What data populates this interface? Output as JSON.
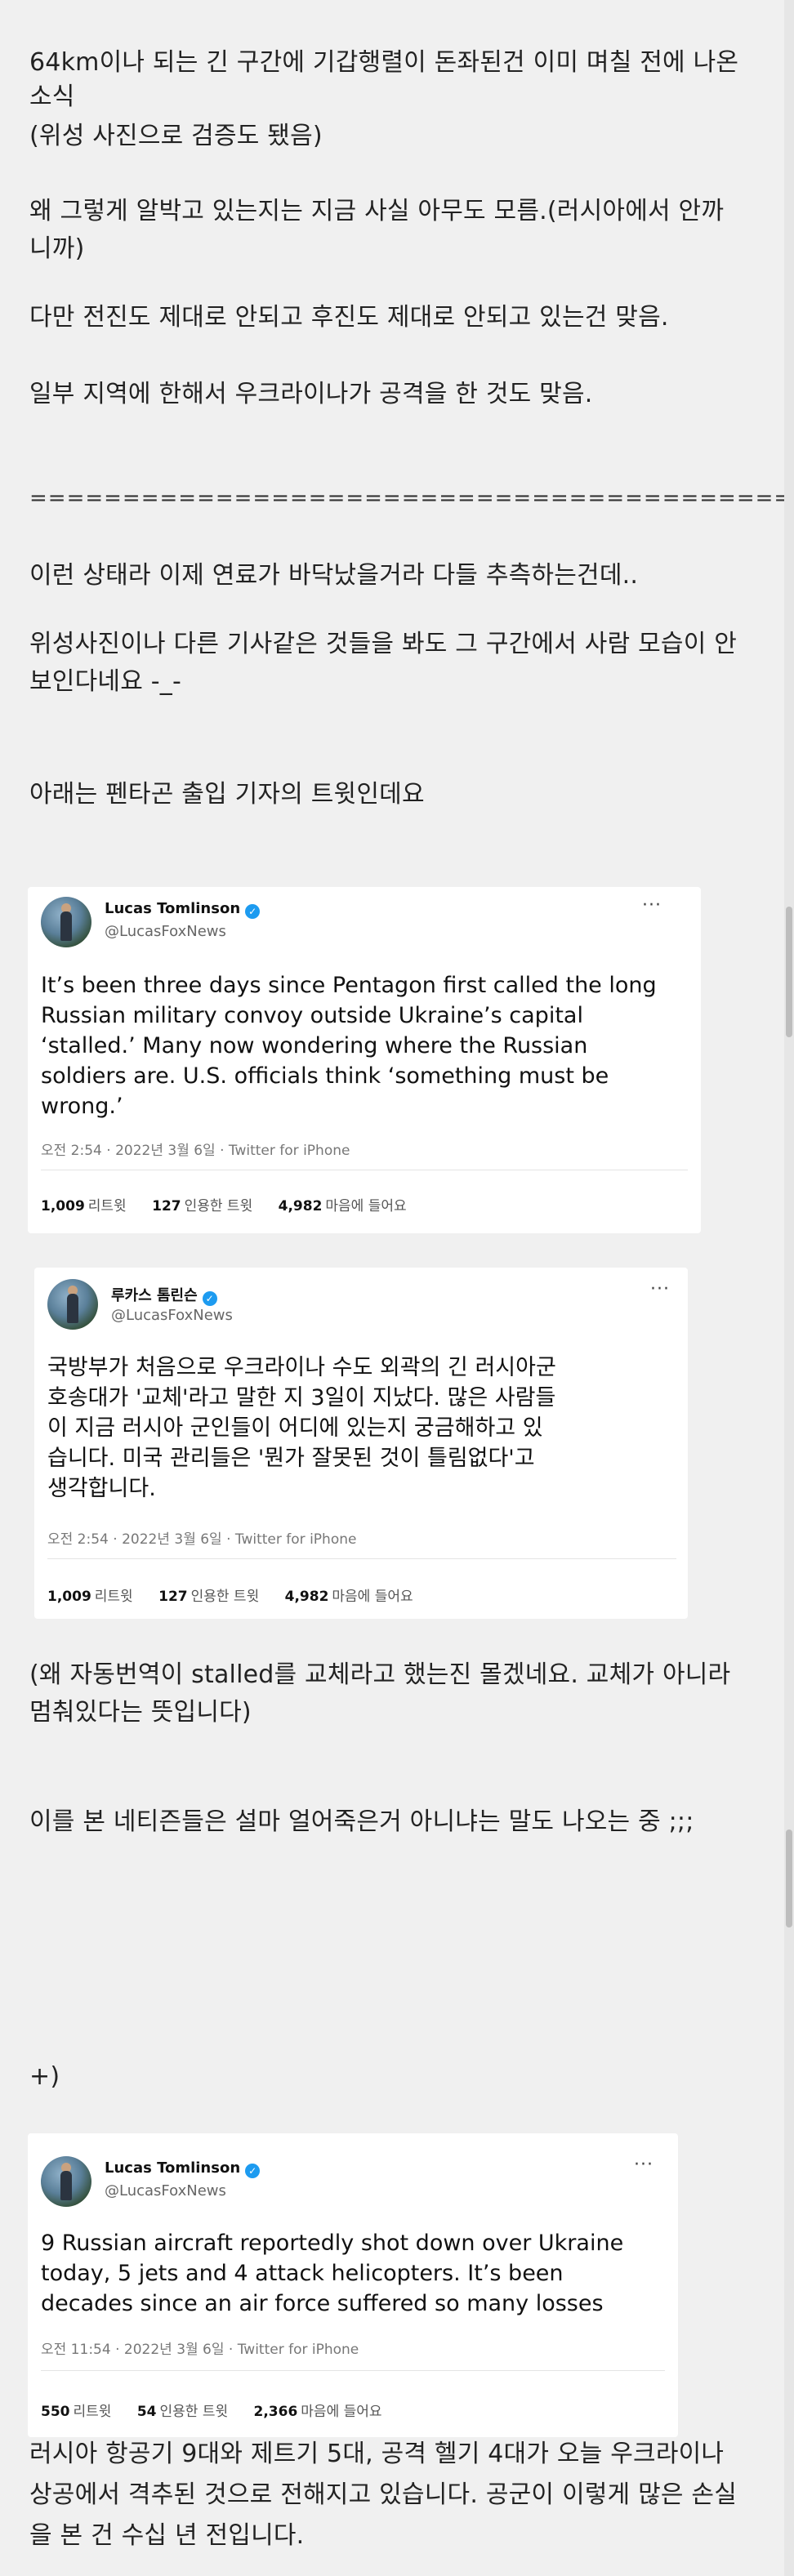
{
  "post": {
    "para1_l1": "64km이나 되는 긴 구간에 기갑행렬이 돈좌된건 이미 며칠 전에 나온",
    "para1_l2": "소식",
    "para1_l3": "(위성 사진으로 검증도 됐음)",
    "para2_l1": "왜 그렇게 알박고 있는지는 지금 사실 아무도 모름.(러시아에서 안까",
    "para2_l2": "니까)",
    "para3": "다만 전진도 제대로 안되고 후진도 제대로 안되고 있는건 맞음.",
    "para4": "일부 지역에 한해서 우크라이나가 공격을 한 것도 맞음.",
    "separator": "=========================================",
    "para5": "이런 상태라 이제 연료가 바닥났을거라 다들 추측하는건데..",
    "para6_l1": "위성사진이나 다른 기사같은 것들을 봐도 그 구간에서 사람 모습이 안",
    "para6_l2": "보인다네요 -_-",
    "para7": "아래는 펜타곤 출입 기자의 트윗인데요",
    "para8_l1": "(왜 자동번역이 stalled를 교체라고 했는진 몰겠네요. 교체가 아니라",
    "para8_l2": "멈춰있다는 뜻입니다)",
    "para9": "이를 본 네티즌들은 설마 얼어죽은거 아니냐는 말도 나오는 중 ;;;",
    "plus": "+)",
    "para10_l1": "러시아 항공기 9대와 제트기 5대, 공격 헬기 4대가 오늘 우크라이나",
    "para10_l2": "상공에서 격추된 것으로 전해지고 있습니다. 공군이 이렇게 많은 손실",
    "para10_l3": "을 본 건 수십 년 전입니다."
  },
  "tweet1": {
    "name": "Lucas Tomlinson",
    "handle": "@LucasFoxNews",
    "more": "···",
    "lines": [
      "It’s been three days since Pentagon first called the long",
      "Russian military convoy outside Ukraine’s capital",
      "‘stalled.’ Many now wondering where the Russian",
      "soldiers are. U.S. officials think ‘something must be",
      "wrong.’"
    ],
    "meta": "오전 2:54 · 2022년 3월 6일 · Twitter for iPhone",
    "retweets": "1,009",
    "retweets_label": "리트윗",
    "quotes": "127",
    "quotes_label": "인용한 트윗",
    "likes": "4,982",
    "likes_label": "마음에 들어요"
  },
  "tweet2": {
    "name": "루카스 톰린슨",
    "handle": "@LucasFoxNews",
    "more": "···",
    "lines": [
      "국방부가 처음으로 우크라이나 수도 외곽의 긴 러시아군",
      "호송대가 '교체'라고 말한 지 3일이 지났다. 많은 사람들",
      "이 지금 러시아 군인들이 어디에 있는지 궁금해하고 있",
      "습니다. 미국 관리들은 '뭔가 잘못된 것이 틀림없다'고",
      "생각합니다."
    ],
    "meta": "오전 2:54 · 2022년 3월 6일 · Twitter for iPhone",
    "retweets": "1,009",
    "retweets_label": "리트윗",
    "quotes": "127",
    "quotes_label": "인용한 트윗",
    "likes": "4,982",
    "likes_label": "마음에 들어요"
  },
  "tweet3": {
    "name": "Lucas Tomlinson",
    "handle": "@LucasFoxNews",
    "more": "···",
    "lines": [
      "9 Russian aircraft reportedly shot down over Ukraine",
      "today, 5 jets and 4 attack helicopters. It’s been",
      "decades since an air force suffered so many losses"
    ],
    "meta": "오전 11:54 · 2022년 3월 6일 · Twitter for iPhone",
    "retweets": "550",
    "retweets_label": "리트윗",
    "quotes": "54",
    "quotes_label": "인용한 트윗",
    "likes": "2,366",
    "likes_label": "마음에 들어요"
  }
}
